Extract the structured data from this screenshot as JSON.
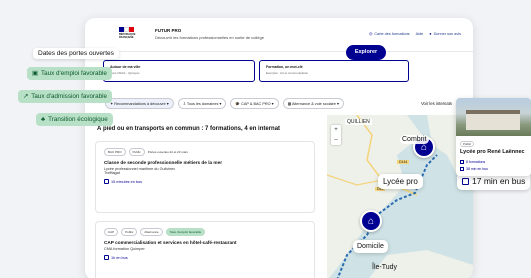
{
  "header": {
    "logo_text": "République Française",
    "title": "FUTUR PRO",
    "subtitle": "Découvrir les formations professionnelles en sortie de collège",
    "links": [
      "Carte des formations",
      "Aide",
      "Donner son avis"
    ]
  },
  "search": {
    "city_label": "Autour de ma ville",
    "city_value": "Pont-l'Abbé - Quimper",
    "formation_label": "Formation, un mot-clé",
    "formation_placeholder": "Exemple : Art et communication",
    "explore_label": "Explorer"
  },
  "filters": [
    "Recommandations à découvrir",
    "Tous les domaines",
    "CAP & BAC PRO",
    "Alternance & voie scolaire"
  ],
  "voir_link": "Voir les internats",
  "list_title": "À pied ou en transports en commun : 7 formations, 4 en internat",
  "items": [
    {
      "tags": [
        "BAC PRO",
        "Public",
        "Portes ouvertes 22 et 23 mars"
      ],
      "title": "Classe de seconde professionnelle métiers de la mer",
      "school": "Lycée professionnel maritime du Guilvinec",
      "town": "Treffiagat",
      "transport": "15 minutes en bus"
    },
    {
      "tags": [
        "CAP",
        "Public",
        "Alternance",
        "Taux d'emploi favorable"
      ],
      "title": "CAP commercialisation et services en hôtel-café-restaurant",
      "school": "CMA formation Quimper",
      "transport": "1h en bus"
    }
  ],
  "floating": {
    "dates": "Dates des portes ouvertes",
    "emploi": "Taux d'emploi favorable",
    "admission": "Taux d'admission favorable",
    "transition": "Transition écologique"
  },
  "map": {
    "labels": {
      "quillien": "QUILLIEN",
      "combrit": "Combrit",
      "tudy": "Île-Tudy",
      "road1": "D44",
      "road2": "D144"
    },
    "lycee": "Lycée pro",
    "domicile": "Domicile",
    "zoom_in": "+",
    "zoom_out": "–"
  },
  "school_card": {
    "tag": "Public",
    "title": "Lycée pro René Laënnec",
    "formations": "8 formations",
    "time": "38 min en bus"
  },
  "travel_time": "17 min en bus",
  "colors": {
    "primary": "#000091",
    "green": "#b8e0c6",
    "green_text": "#0b5a2c"
  }
}
